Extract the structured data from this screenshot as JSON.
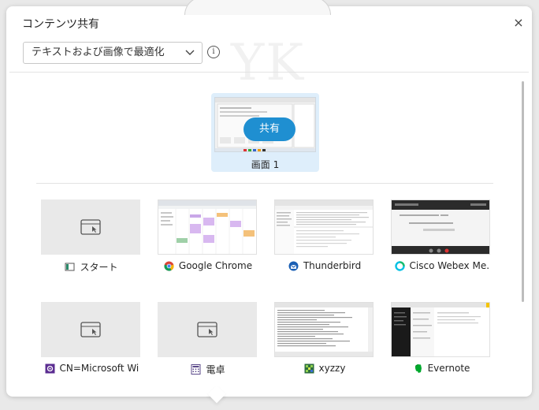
{
  "dialog": {
    "title": "コンテンツ共有",
    "close_glyph": "×",
    "optimize_select": {
      "value": "テキストおよび画像で最適化"
    },
    "info_glyph": "i"
  },
  "screens": [
    {
      "share_label": "共有",
      "label": "画面 1"
    }
  ],
  "apps": [
    {
      "label": "スタート",
      "icon": "start-icon",
      "thumb": "blank"
    },
    {
      "label": "Google Chrome",
      "icon": "chrome-icon",
      "thumb": "calendar"
    },
    {
      "label": "Thunderbird",
      "icon": "thunderbird-icon",
      "thumb": "mail"
    },
    {
      "label": "Cisco Webex Me...",
      "icon": "webex-icon",
      "thumb": "dark"
    },
    {
      "label": "CN=Microsoft Wi...",
      "icon": "settings-icon",
      "thumb": "blank"
    },
    {
      "label": "電卓",
      "icon": "calculator-icon",
      "thumb": "blank"
    },
    {
      "label": "xyzzy",
      "icon": "xyzzy-icon",
      "thumb": "editor"
    },
    {
      "label": "Evernote",
      "icon": "evernote-icon",
      "thumb": "notes"
    }
  ],
  "colors": {
    "accent": "#1f8fd1",
    "selected_bg": "#deeefb"
  }
}
